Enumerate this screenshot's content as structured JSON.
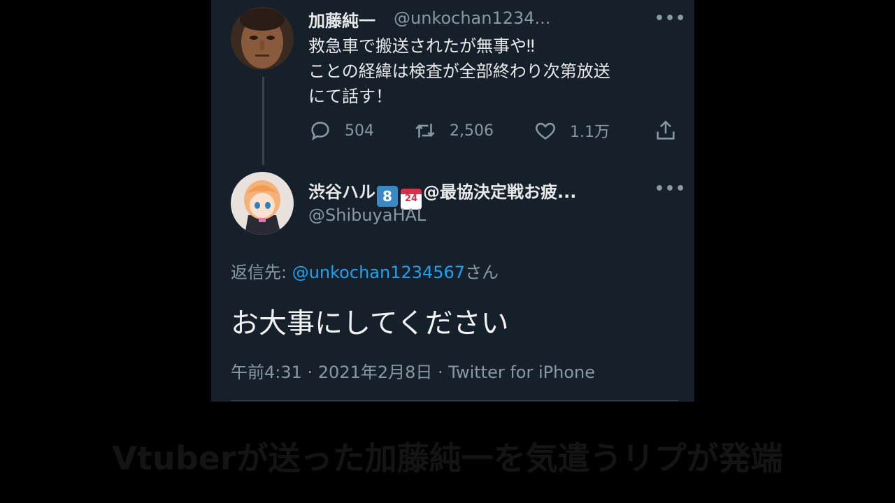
{
  "tweet1": {
    "name": "加藤純一",
    "handle": "@unkochan1234...",
    "text": "救急車で搬送されたが無事や‼\nことの経緯は検査が全部終わり次第放送\nにて話す！",
    "replies": "504",
    "retweets": "2,506",
    "likes": "1.1万"
  },
  "tweet2": {
    "name_prefix": "渋谷ハル",
    "badge_number": "8",
    "badge_calendar": "24",
    "name_suffix": "@最協決定戦お疲...",
    "handle": "@ShibuyaHAL",
    "reply_label": "返信先: ",
    "reply_mention": "@unkochan1234567",
    "reply_suffix": "さん",
    "text": "お大事にしてください",
    "meta": "午前4:31 · 2021年2月8日 · Twitter for iPhone"
  },
  "more_glyph": "•••",
  "caption": "Vtuberが送った加藤純一を気遣うリプが発端",
  "colors": {
    "background": "#15202b",
    "accent": "#1da1f2",
    "secondary_text": "#8899a6",
    "primary_text": "#e9e9e9"
  },
  "icons": [
    "reply-icon",
    "retweet-icon",
    "like-icon",
    "share-icon",
    "more-icon"
  ]
}
